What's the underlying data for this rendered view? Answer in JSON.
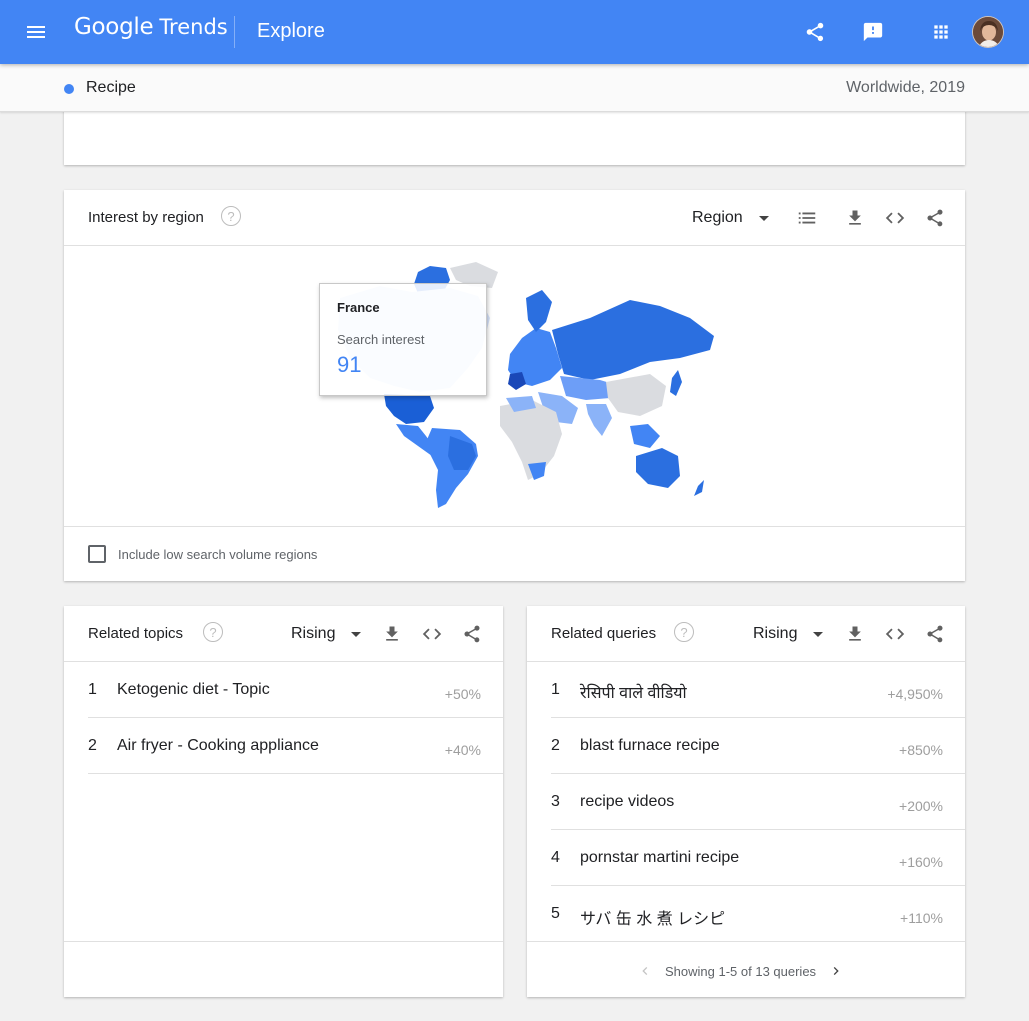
{
  "header": {
    "logo_google": "Google",
    "logo_trends": "Trends",
    "section": "Explore",
    "icons": [
      "menu-icon",
      "share-icon",
      "feedback-icon",
      "apps-icon",
      "avatar"
    ]
  },
  "term_bar": {
    "term": "Recipe",
    "term_color": "#4285f4",
    "scope": "Worldwide, 2019"
  },
  "interest_by_region": {
    "title": "Interest by region",
    "help": "?",
    "resolution": "Region",
    "tooltip": {
      "region": "France",
      "label": "Search interest",
      "value": "91"
    },
    "low_volume_label": "Include low search volume regions",
    "low_volume_checked": false,
    "colors": {
      "high": "#1a73e8",
      "mid": "#4285f4",
      "low": "#aecbfa",
      "none": "#dadce0"
    }
  },
  "related_topics": {
    "title": "Related topics",
    "help": "?",
    "filter": "Rising",
    "rows": [
      {
        "rank": "1",
        "text": "Ketogenic diet - Topic",
        "value": "+50%"
      },
      {
        "rank": "2",
        "text": "Air fryer - Cooking appliance",
        "value": "+40%"
      }
    ]
  },
  "related_queries": {
    "title": "Related queries",
    "help": "?",
    "filter": "Rising",
    "rows": [
      {
        "rank": "1",
        "text": "रेसिपी वाले वीडियो",
        "value": "+4,950%"
      },
      {
        "rank": "2",
        "text": "blast furnace recipe",
        "value": "+850%"
      },
      {
        "rank": "3",
        "text": "recipe videos",
        "value": "+200%"
      },
      {
        "rank": "4",
        "text": "pornstar martini recipe",
        "value": "+160%"
      },
      {
        "rank": "5",
        "text": "サバ 缶 水 煮 レシピ",
        "value": "+110%"
      }
    ],
    "pagination": "Showing 1-5 of 13 queries"
  }
}
